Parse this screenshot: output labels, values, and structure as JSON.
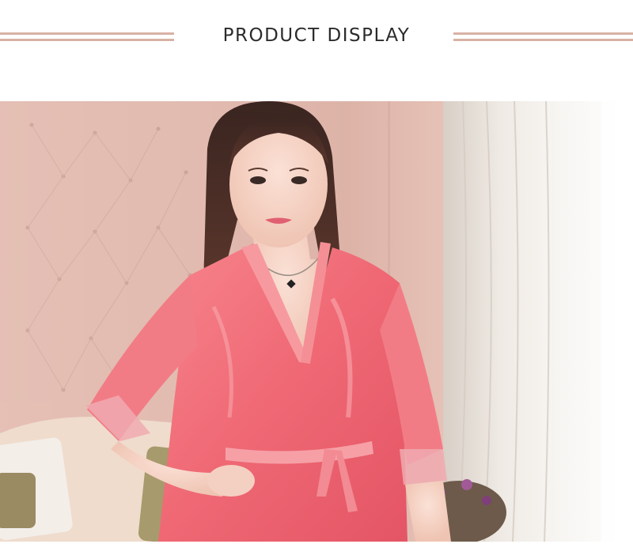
{
  "header": {
    "title": "PRODUCT DISPLAY",
    "rule_color": "#d9b2a5"
  },
  "photo": {
    "subject": "model-in-satin-robe",
    "robe_color": "#f0707a",
    "wall_color": "#e6c2b8",
    "curtain_color": "#f3f0ec"
  }
}
